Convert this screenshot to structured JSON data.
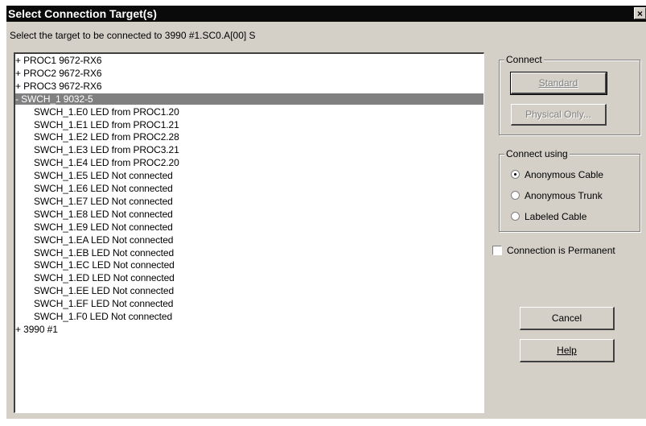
{
  "window": {
    "title": "Select Connection Target(s)",
    "close_glyph": "×"
  },
  "instruction": "Select the target to be connected to 3990 #1.SC0.A[00] S",
  "tree": {
    "items": [
      {
        "label": "+ PROC1 9672-RX6",
        "level": 0,
        "selected": false
      },
      {
        "label": "+ PROC2 9672-RX6",
        "level": 0,
        "selected": false
      },
      {
        "label": "+ PROC3 9672-RX6",
        "level": 0,
        "selected": false
      },
      {
        "label": "- SWCH_1 9032-5",
        "level": 0,
        "selected": true
      },
      {
        "label": "SWCH_1.E0 LED from PROC1.20",
        "level": 1,
        "selected": false
      },
      {
        "label": "SWCH_1.E1 LED from PROC1.21",
        "level": 1,
        "selected": false
      },
      {
        "label": "SWCH_1.E2 LED from PROC2.28",
        "level": 1,
        "selected": false
      },
      {
        "label": "SWCH_1.E3 LED from PROC3.21",
        "level": 1,
        "selected": false
      },
      {
        "label": "SWCH_1.E4 LED from PROC2.20",
        "level": 1,
        "selected": false
      },
      {
        "label": "SWCH_1.E5 LED Not connected",
        "level": 1,
        "selected": false
      },
      {
        "label": "SWCH_1.E6 LED Not connected",
        "level": 1,
        "selected": false
      },
      {
        "label": "SWCH_1.E7 LED Not connected",
        "level": 1,
        "selected": false
      },
      {
        "label": "SWCH_1.E8 LED Not connected",
        "level": 1,
        "selected": false
      },
      {
        "label": "SWCH_1.E9 LED Not connected",
        "level": 1,
        "selected": false
      },
      {
        "label": "SWCH_1.EA LED Not connected",
        "level": 1,
        "selected": false
      },
      {
        "label": "SWCH_1.EB LED Not connected",
        "level": 1,
        "selected": false
      },
      {
        "label": "SWCH_1.EC LED Not connected",
        "level": 1,
        "selected": false
      },
      {
        "label": "SWCH_1.ED LED Not connected",
        "level": 1,
        "selected": false
      },
      {
        "label": "SWCH_1.EE LED Not connected",
        "level": 1,
        "selected": false
      },
      {
        "label": "SWCH_1.EF LED Not connected",
        "level": 1,
        "selected": false
      },
      {
        "label": "SWCH_1.F0 LED Not connected",
        "level": 1,
        "selected": false
      },
      {
        "label": "+ 3990 #1",
        "level": 0,
        "selected": false
      }
    ]
  },
  "connect": {
    "label": "Connect",
    "standard": {
      "label": "Standard",
      "enabled": false
    },
    "physical_only": {
      "label": "Physical Only...",
      "enabled": false
    }
  },
  "connect_using": {
    "label": "Connect using",
    "options": [
      {
        "label": "Anonymous Cable",
        "checked": true
      },
      {
        "label": "Anonymous Trunk",
        "checked": false
      },
      {
        "label": "Labeled Cable",
        "checked": false
      }
    ]
  },
  "permanent": {
    "label": "Connection is Permanent",
    "checked": false
  },
  "buttons": {
    "cancel": "Cancel",
    "help": "Help"
  }
}
